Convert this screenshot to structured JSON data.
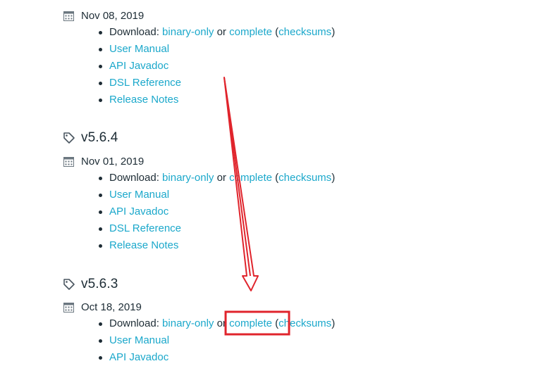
{
  "releases": [
    {
      "version": "",
      "date": "Nov 08, 2019",
      "download_prefix": "Download: ",
      "binary_only": "binary-only",
      "or": " or ",
      "complete": "complete",
      "paren_open": " (",
      "checksums": "checksums",
      "paren_close": ")",
      "links": [
        "User Manual",
        "API Javadoc",
        "DSL Reference",
        "Release Notes"
      ]
    },
    {
      "version": "v5.6.4",
      "date": "Nov 01, 2019",
      "download_prefix": "Download: ",
      "binary_only": "binary-only",
      "or": " or ",
      "complete": "complete",
      "paren_open": " (",
      "checksums": "checksums",
      "paren_close": ")",
      "links": [
        "User Manual",
        "API Javadoc",
        "DSL Reference",
        "Release Notes"
      ]
    },
    {
      "version": "v5.6.3",
      "date": "Oct 18, 2019",
      "download_prefix": "Download: ",
      "binary_only": "binary-only",
      "or": " or ",
      "complete": "complete",
      "paren_open": " (",
      "checksums": "checksums",
      "paren_close": ")",
      "links": [
        "User Manual",
        "API Javadoc"
      ]
    }
  ],
  "annotation": {
    "arrow_color": "#e0242c",
    "highlight_color": "#e0242c",
    "highlight_target": "complete"
  },
  "colors": {
    "link": "#1ba8cb",
    "text": "#1d2c35",
    "icon": "#6b7780"
  }
}
